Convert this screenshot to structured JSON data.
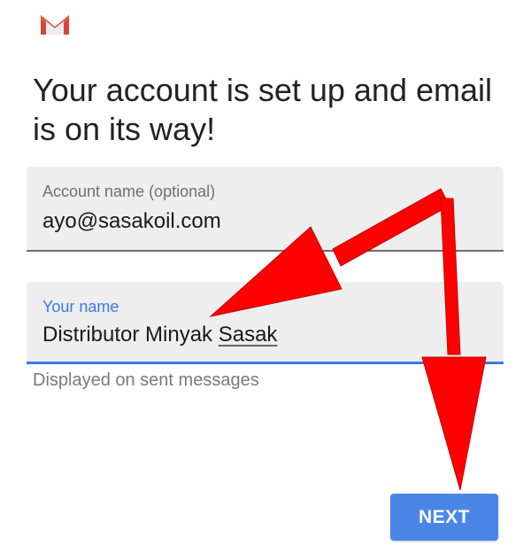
{
  "app": {
    "logo": "gmail-logo"
  },
  "header": {
    "title": "Your account is set up and email is on its way!"
  },
  "form": {
    "account_name": {
      "label": "Account name (optional)",
      "value": "ayo@sasakoil.com"
    },
    "your_name": {
      "label": "Your name",
      "value_part1": "Distributor Minyak ",
      "value_part2": "Sasak",
      "helper": "Displayed on sent messages"
    }
  },
  "actions": {
    "next_label": "NEXT"
  },
  "colors": {
    "accent": "#4a86e8",
    "field_focus": "#3b78e7",
    "annotation_arrow": "#ff0000"
  }
}
